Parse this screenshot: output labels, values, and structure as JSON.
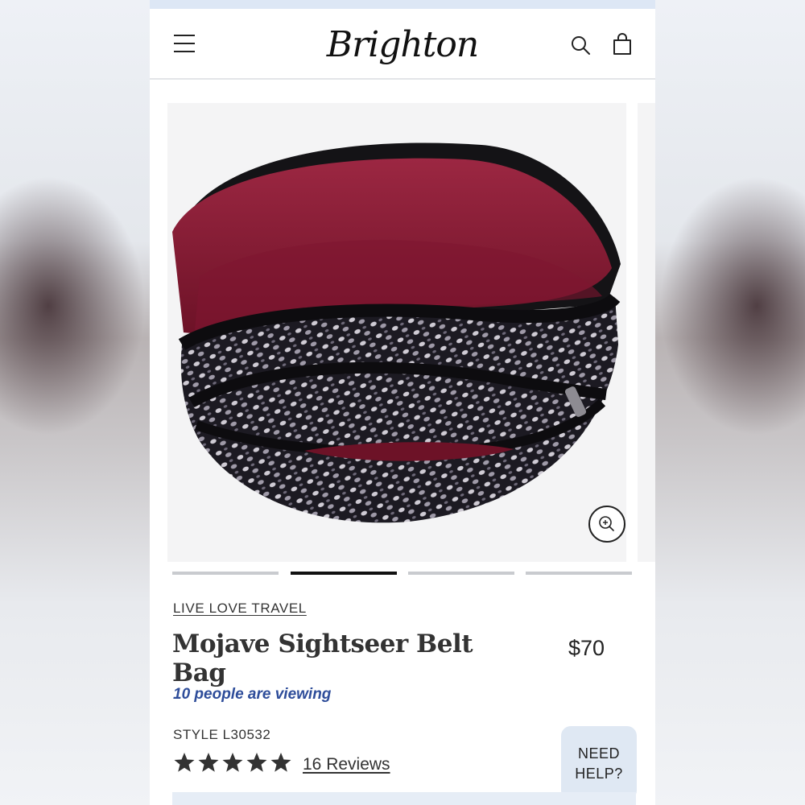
{
  "header": {
    "brand": "Brighton",
    "icons": [
      "menu-icon",
      "search-icon",
      "shopping-bag-icon"
    ]
  },
  "gallery": {
    "slide_count": 4,
    "active_slide": 2,
    "zoom_icon": "zoom-in-icon"
  },
  "product": {
    "collection": "LIVE LOVE TRAVEL",
    "title": "Mojave Sightseer Belt Bag",
    "price": "$70",
    "viewers": "10 people are viewing",
    "style": "STYLE L30532",
    "rating": 5,
    "reviews": "16 Reviews"
  },
  "help": {
    "line1": "NEED",
    "line2": "HELP?"
  },
  "colors": {
    "accent_blue": "#2e4d9a",
    "help_bubble": "#dfe8f3",
    "promo_strip": "#dde7f5",
    "lining_burgundy": "#8a1c38"
  }
}
